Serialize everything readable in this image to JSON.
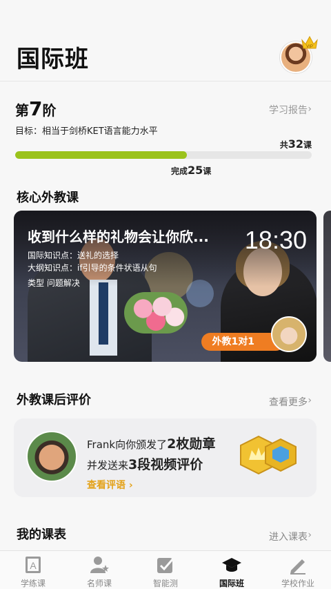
{
  "header": {
    "title": "国际班",
    "avatar_badge": "VIP"
  },
  "level": {
    "prefix": "第",
    "number": "7",
    "suffix": "阶",
    "report_link": "学习报告",
    "goal": "目标：相当于剑桥KET语言能力水平",
    "total_prefix": "共",
    "total_count": "32",
    "total_suffix": "课",
    "completed_prefix": "完成",
    "completed_count": "25",
    "completed_suffix": "课",
    "progress_fraction": 0.58,
    "progress_color": "#9bc31c"
  },
  "core_lessons": {
    "section_title": "核心外教课",
    "card": {
      "title": "收到什么样的礼物会让你欣...",
      "time": "18:30",
      "knowledge_label": "国际知识点：",
      "knowledge_value": "送礼的选择",
      "outline_label": "大纲知识点：",
      "outline_value": "if引导的条件状语从句",
      "type_label": "类型",
      "type_value": "问题解决",
      "badge": "外教1对1",
      "badge_color": "#ef7d22"
    }
  },
  "reviews": {
    "section_title": "外教课后评价",
    "more_link": "查看更多",
    "line1_prefix": "Frank向你颁发了",
    "line1_highlight": "2枚勋章",
    "line2_prefix": "并发送来",
    "line2_highlight": "3段视频评价",
    "action_link": "查看评语",
    "accent_color": "#e3a21a"
  },
  "schedule": {
    "section_title": "我的课表",
    "more_link": "进入课表"
  },
  "tabbar": {
    "items": [
      {
        "label": "学练课",
        "icon": "letter-a-book-icon"
      },
      {
        "label": "名师课",
        "icon": "teacher-star-icon"
      },
      {
        "label": "智能测",
        "icon": "checkbox-test-icon"
      },
      {
        "label": "国际班",
        "icon": "graduation-cap-icon",
        "active": true
      },
      {
        "label": "学校作业",
        "icon": "pencil-icon"
      }
    ]
  }
}
